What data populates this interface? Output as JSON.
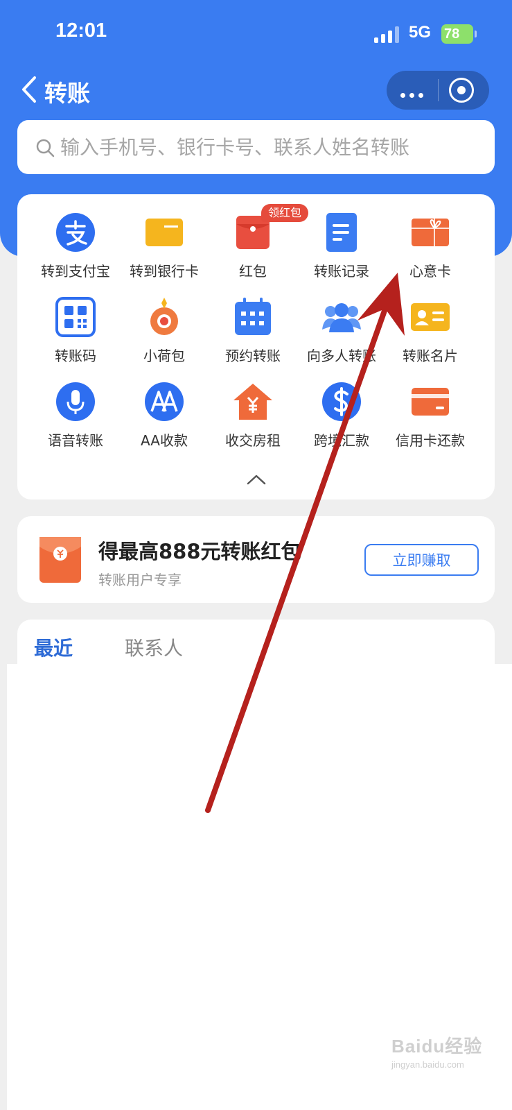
{
  "status_bar": {
    "time": "12:01",
    "network": "5G",
    "battery": "78"
  },
  "nav": {
    "title": "转账"
  },
  "search": {
    "placeholder": "输入手机号、银行卡号、联系人姓名转账"
  },
  "services": [
    {
      "label": "转到支付宝",
      "icon": "alipay-icon"
    },
    {
      "label": "转到银行卡",
      "icon": "bank-card-icon"
    },
    {
      "label": "红包",
      "icon": "red-packet-icon",
      "badge": "领红包"
    },
    {
      "label": "转账记录",
      "icon": "document-icon"
    },
    {
      "label": "心意卡",
      "icon": "gift-card-icon"
    },
    {
      "label": "转账码",
      "icon": "qr-code-icon"
    },
    {
      "label": "小荷包",
      "icon": "pouch-icon"
    },
    {
      "label": "预约转账",
      "icon": "calendar-icon"
    },
    {
      "label": "向多人转账",
      "icon": "group-icon"
    },
    {
      "label": "转账名片",
      "icon": "business-card-icon"
    },
    {
      "label": "语音转账",
      "icon": "microphone-icon"
    },
    {
      "label": "AA收款",
      "icon": "aa-icon"
    },
    {
      "label": "收交房租",
      "icon": "house-icon"
    },
    {
      "label": "跨境汇款",
      "icon": "dollar-icon"
    },
    {
      "label": "信用卡还款",
      "icon": "credit-card-icon"
    }
  ],
  "promo": {
    "title": "得最高888元转账红包",
    "subtitle": "转账用户专享",
    "button": "立即赚取"
  },
  "tabs": [
    "最近",
    "联系人"
  ],
  "watermark": {
    "logo": "Baidu经验",
    "url": "jingyan.baidu.com"
  },
  "colors": {
    "brand_blue": "#3a7cf1",
    "annotation_arrow": "#b5211d",
    "badge_red": "#e54b3c"
  }
}
